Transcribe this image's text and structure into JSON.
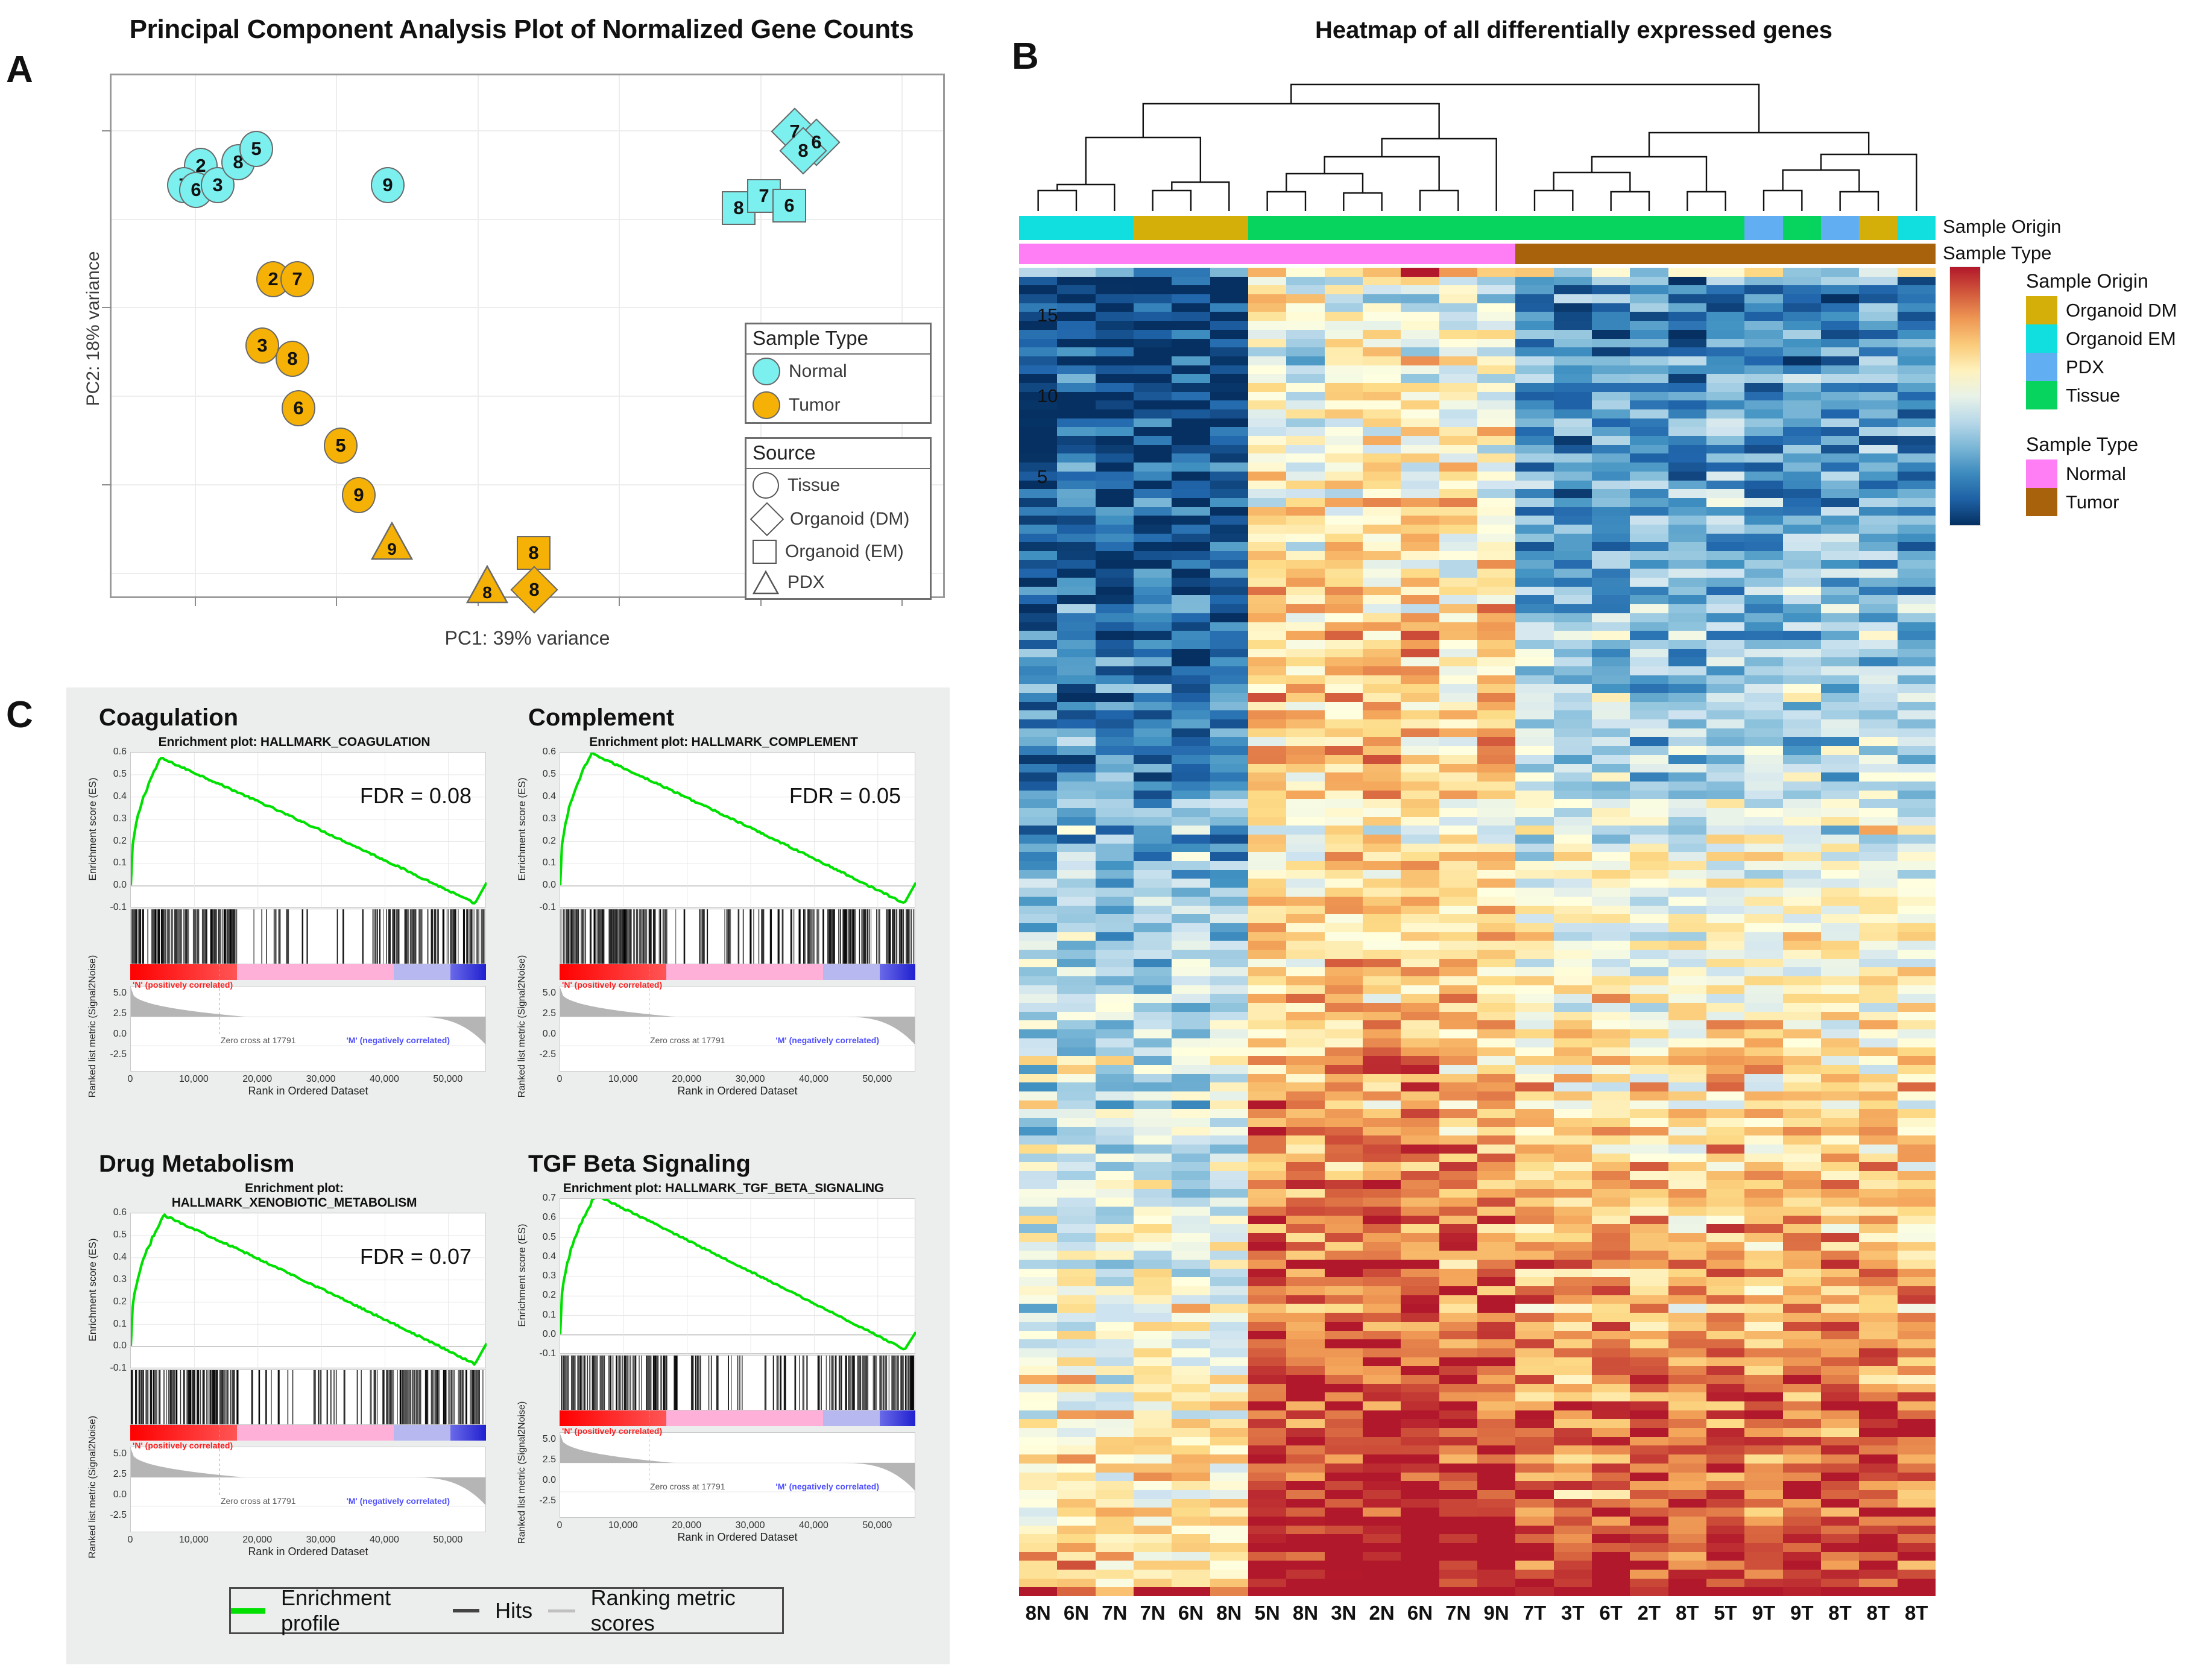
{
  "panels": {
    "a": "A",
    "b": "B",
    "c": "C"
  },
  "pca": {
    "title": "Principal Component Analysis Plot of Normalized Gene Counts",
    "xlabel": "PC1: 39% variance",
    "ylabel": "PC2: 18% variance",
    "legend_type": {
      "title": "Sample Type",
      "items": [
        {
          "label": "Normal",
          "color": "#7bf0ef"
        },
        {
          "label": "Tumor",
          "color": "#f5b105"
        }
      ]
    },
    "legend_source": {
      "title": "Source",
      "items": [
        {
          "label": "Tissue",
          "shape": "circle"
        },
        {
          "label": "Organoid (DM)",
          "shape": "diamond"
        },
        {
          "label": "Organoid (EM)",
          "shape": "square"
        },
        {
          "label": "PDX",
          "shape": "triangle"
        }
      ]
    },
    "points": [
      {
        "label": "2",
        "x": 120,
        "y": 120,
        "shape": "circle",
        "type": "Normal"
      },
      {
        "label": "7",
        "x": 92,
        "y": 152,
        "shape": "circle",
        "type": "Normal"
      },
      {
        "label": "6",
        "x": 112,
        "y": 160,
        "shape": "circle",
        "type": "Normal"
      },
      {
        "label": "3",
        "x": 148,
        "y": 152,
        "shape": "circle",
        "type": "Normal"
      },
      {
        "label": "8",
        "x": 182,
        "y": 114,
        "shape": "circle",
        "type": "Normal"
      },
      {
        "label": "5",
        "x": 212,
        "y": 92,
        "shape": "circle",
        "type": "Normal"
      },
      {
        "label": "9",
        "x": 430,
        "y": 152,
        "shape": "circle",
        "type": "Normal"
      },
      {
        "label": "2",
        "x": 240,
        "y": 308,
        "shape": "circle",
        "type": "Tumor"
      },
      {
        "label": "7",
        "x": 280,
        "y": 308,
        "shape": "circle",
        "type": "Tumor"
      },
      {
        "label": "3",
        "x": 222,
        "y": 418,
        "shape": "circle",
        "type": "Tumor"
      },
      {
        "label": "8",
        "x": 272,
        "y": 440,
        "shape": "circle",
        "type": "Tumor"
      },
      {
        "label": "6",
        "x": 282,
        "y": 522,
        "shape": "circle",
        "type": "Tumor"
      },
      {
        "label": "5",
        "x": 352,
        "y": 584,
        "shape": "circle",
        "type": "Tumor"
      },
      {
        "label": "9",
        "x": 382,
        "y": 666,
        "shape": "circle",
        "type": "Tumor"
      },
      {
        "label": "7",
        "x": 1096,
        "y": 56,
        "shape": "diamond",
        "type": "Normal"
      },
      {
        "label": "6",
        "x": 1132,
        "y": 74,
        "shape": "diamond",
        "type": "Normal"
      },
      {
        "label": "8",
        "x": 1110,
        "y": 88,
        "shape": "diamond",
        "type": "Normal"
      },
      {
        "label": "8",
        "x": 1012,
        "y": 192,
        "shape": "square",
        "type": "Normal"
      },
      {
        "label": "7",
        "x": 1054,
        "y": 172,
        "shape": "square",
        "type": "Normal"
      },
      {
        "label": "6",
        "x": 1096,
        "y": 188,
        "shape": "square",
        "type": "Normal"
      },
      {
        "label": "9",
        "x": 430,
        "y": 740,
        "shape": "triangle",
        "type": "Tumor"
      },
      {
        "label": "8",
        "x": 588,
        "y": 812,
        "shape": "triangle",
        "type": "Tumor"
      },
      {
        "label": "8",
        "x": 672,
        "y": 764,
        "shape": "square",
        "type": "Tumor"
      },
      {
        "label": "8",
        "x": 664,
        "y": 816,
        "shape": "diamond",
        "type": "Tumor"
      }
    ]
  },
  "heatmap": {
    "title": "Heatmap of all differentially expressed genes",
    "annotation_labels": {
      "origin": "Sample Origin",
      "type": "Sample Type"
    },
    "columns": [
      "8N",
      "6N",
      "7N",
      "7N",
      "6N",
      "8N",
      "5N",
      "8N",
      "3N",
      "2N",
      "6N",
      "7N",
      "9N",
      "7T",
      "3T",
      "6T",
      "2T",
      "8T",
      "5T",
      "9T",
      "9T",
      "8T",
      "8T",
      "8T"
    ],
    "sample_origin": [
      "Organoid EM",
      "Organoid EM",
      "Organoid EM",
      "Organoid DM",
      "Organoid DM",
      "Organoid DM",
      "Tissue",
      "Tissue",
      "Tissue",
      "Tissue",
      "Tissue",
      "Tissue",
      "Tissue",
      "Tissue",
      "Tissue",
      "Tissue",
      "Tissue",
      "Tissue",
      "Tissue",
      "PDX",
      "Tissue",
      "PDX",
      "Organoid DM",
      "Organoid EM"
    ],
    "sample_type": [
      "Normal",
      "Normal",
      "Normal",
      "Normal",
      "Normal",
      "Normal",
      "Normal",
      "Normal",
      "Normal",
      "Normal",
      "Normal",
      "Normal",
      "Normal",
      "Tumor",
      "Tumor",
      "Tumor",
      "Tumor",
      "Tumor",
      "Tumor",
      "Tumor",
      "Tumor",
      "Tumor",
      "Tumor",
      "Tumor"
    ],
    "colorbar": {
      "ticks": [
        "15",
        "10",
        "5"
      ],
      "min": 2,
      "max": 18
    },
    "legend_origin": {
      "title": "Sample Origin",
      "items": [
        {
          "label": "Organoid DM",
          "color": "#d4af0a"
        },
        {
          "label": "Organoid EM",
          "color": "#11dede"
        },
        {
          "label": "PDX",
          "color": "#62aef2"
        },
        {
          "label": "Tissue",
          "color": "#07d45f"
        }
      ]
    },
    "legend_type": {
      "title": "Sample Type",
      "items": [
        {
          "label": "Normal",
          "color": "#ff7ef5"
        },
        {
          "label": "Tumor",
          "color": "#a8620c"
        }
      ]
    }
  },
  "gsea": {
    "legend": {
      "enrichment_profile": "Enrichment profile",
      "hits": "Hits",
      "ranking_metric": "Ranking metric scores"
    },
    "axis": {
      "ylabel_top": "Enrichment score (ES)",
      "ylabel_bottom": "Ranked list metric (Signal2Noise)",
      "xlabel": "Rank in Ordered Dataset",
      "yticks_top": [
        "0.6",
        "0.5",
        "0.4",
        "0.3",
        "0.2",
        "0.1",
        "0.0",
        "-0.1"
      ],
      "yticks_bottom": [
        "5.0",
        "2.5",
        "0.0",
        "-2.5"
      ],
      "xticks": [
        "0",
        "10,000",
        "20,000",
        "30,000",
        "40,000",
        "50,000"
      ],
      "pos_corr": "'N' (positively correlated)",
      "neg_corr": "'M' (negatively correlated)",
      "zero_cross": "Zero cross at 17791"
    },
    "plots": [
      {
        "heading": "Coagulation",
        "subtitle": "Enrichment plot: HALLMARK_COAGULATION",
        "fdr": "FDR = 0.08",
        "peak": 0.575
      },
      {
        "heading": "Complement",
        "subtitle": "Enrichment plot: HALLMARK_COMPLEMENT",
        "fdr": "FDR = 0.05",
        "peak": 0.595
      },
      {
        "heading": "Drug Metabolism",
        "subtitle": "Enrichment plot:\nHALLMARK_XENOBIOTIC_METABOLISM",
        "fdr": "FDR = 0.07",
        "peak": 0.59
      },
      {
        "heading": "TGF Beta Signaling",
        "subtitle": "Enrichment plot: HALLMARK_TGF_BETA_SIGNALING",
        "fdr": "",
        "peak": 0.72
      }
    ]
  },
  "chart_data": [
    {
      "type": "scatter",
      "title": "Principal Component Analysis Plot of Normalized Gene Counts",
      "xlabel": "PC1: 39% variance",
      "ylabel": "PC2: 18% variance",
      "grid": true,
      "legend_position": "right",
      "series": [
        {
          "name": "Normal",
          "color": "#7bf0ef",
          "points": [
            {
              "label": "2",
              "shape": "circle"
            },
            {
              "label": "7",
              "shape": "circle"
            },
            {
              "label": "6",
              "shape": "circle"
            },
            {
              "label": "3",
              "shape": "circle"
            },
            {
              "label": "8",
              "shape": "circle"
            },
            {
              "label": "5",
              "shape": "circle"
            },
            {
              "label": "9",
              "shape": "circle"
            },
            {
              "label": "7",
              "shape": "diamond"
            },
            {
              "label": "6",
              "shape": "diamond"
            },
            {
              "label": "8",
              "shape": "diamond"
            },
            {
              "label": "8",
              "shape": "square"
            },
            {
              "label": "7",
              "shape": "square"
            },
            {
              "label": "6",
              "shape": "square"
            }
          ]
        },
        {
          "name": "Tumor",
          "color": "#f5b105",
          "points": [
            {
              "label": "2",
              "shape": "circle"
            },
            {
              "label": "7",
              "shape": "circle"
            },
            {
              "label": "3",
              "shape": "circle"
            },
            {
              "label": "8",
              "shape": "circle"
            },
            {
              "label": "6",
              "shape": "circle"
            },
            {
              "label": "5",
              "shape": "circle"
            },
            {
              "label": "9",
              "shape": "circle"
            },
            {
              "label": "9",
              "shape": "triangle"
            },
            {
              "label": "8",
              "shape": "triangle"
            },
            {
              "label": "8",
              "shape": "square"
            },
            {
              "label": "8",
              "shape": "diamond"
            }
          ]
        }
      ]
    },
    {
      "type": "heatmap",
      "title": "Heatmap of all differentially expressed genes",
      "xlabel": "",
      "ylabel": "",
      "xticklabels": [
        "8N",
        "6N",
        "7N",
        "7N",
        "6N",
        "8N",
        "5N",
        "8N",
        "3N",
        "2N",
        "6N",
        "7N",
        "9N",
        "7T",
        "3T",
        "6T",
        "2T",
        "8T",
        "5T",
        "9T",
        "9T",
        "8T",
        "8T",
        "8T"
      ],
      "colorbar_ticks": [
        5,
        10,
        15
      ],
      "colorbar_range": [
        2,
        18
      ],
      "colormap": "RdYlBu reversed",
      "n_columns": 24,
      "row_annotations": [
        "Sample Origin",
        "Sample Type"
      ]
    },
    {
      "type": "line",
      "title": "Enrichment plot: HALLMARK_COAGULATION",
      "xlabel": "Rank in Ordered Dataset",
      "ylabel": "Enrichment score (ES)",
      "ylim": [
        -0.1,
        0.6
      ],
      "xlim": [
        0,
        56000
      ],
      "annotations": [
        "FDR = 0.08",
        "Zero cross at 17791"
      ],
      "peak_es": 0.575
    },
    {
      "type": "line",
      "title": "Enrichment plot: HALLMARK_COMPLEMENT",
      "xlabel": "Rank in Ordered Dataset",
      "ylabel": "Enrichment score (ES)",
      "ylim": [
        -0.1,
        0.6
      ],
      "xlim": [
        0,
        56000
      ],
      "annotations": [
        "FDR = 0.05",
        "Zero cross at 17791"
      ],
      "peak_es": 0.595
    },
    {
      "type": "line",
      "title": "Enrichment plot: HALLMARK_XENOBIOTIC_METABOLISM",
      "xlabel": "Rank in Ordered Dataset",
      "ylabel": "Enrichment score (ES)",
      "ylim": [
        -0.1,
        0.6
      ],
      "xlim": [
        0,
        56000
      ],
      "annotations": [
        "FDR = 0.07",
        "Zero cross at 17791"
      ],
      "peak_es": 0.59
    },
    {
      "type": "line",
      "title": "Enrichment plot: HALLMARK_TGF_BETA_SIGNALING",
      "xlabel": "Rank in Ordered Dataset",
      "ylabel": "Enrichment score (ES)",
      "ylim": [
        -0.1,
        0.7
      ],
      "xlim": [
        0,
        56000
      ],
      "annotations": [
        "Zero cross at 17791"
      ],
      "peak_es": 0.72
    }
  ]
}
